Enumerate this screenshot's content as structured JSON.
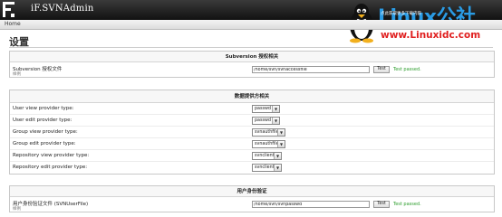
{
  "app": {
    "title": "iF.SVNAdmin"
  },
  "watermark": {
    "brand": "Linux公社",
    "url": "www.Linuxidc.com",
    "tip": "点此获取更多下载内容"
  },
  "nav": {
    "home": "Home"
  },
  "page": {
    "title": "设置"
  },
  "subversion": {
    "heading": "Subversion 授权相关",
    "authz_label": "Subversion 授权文件",
    "authz_sub": "样例",
    "authz_value": "/home/svn/svnaccessfile",
    "test_label": "Test",
    "status": "Test passed."
  },
  "providers": {
    "heading": "数据提供方相关",
    "rows": [
      {
        "label": "User view provider type:",
        "value": "passwd"
      },
      {
        "label": "User edit provider type:",
        "value": "passwd"
      },
      {
        "label": "Group view provider type:",
        "value": "svnauthfile"
      },
      {
        "label": "Group edit provider type:",
        "value": "svnauthfile"
      },
      {
        "label": "Repository view provider type:",
        "value": "svnclient"
      },
      {
        "label": "Repository edit provider type:",
        "value": "svnclient"
      }
    ]
  },
  "userauth": {
    "heading": "用户身份验证",
    "file_label": "用户身份验证文件 (SVNUserFile)",
    "file_sub": "样例",
    "file_value": "/home/svn/svnpasswd",
    "test_label": "Test",
    "status": "Test passed."
  },
  "colors": {
    "topbar": "#1a1a1a",
    "status_ok": "#2f9e2f",
    "watermark_blue": "#2a9be4",
    "watermark_red": "#e02020"
  }
}
